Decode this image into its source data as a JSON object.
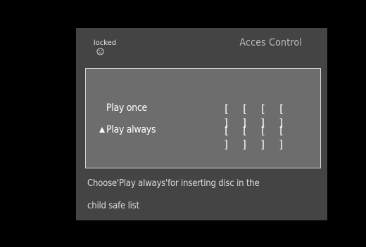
{
  "header": {
    "status_text": "locked",
    "status_icon": "sad-face-icon",
    "title": "Acces Control"
  },
  "options": [
    {
      "label": "Play once",
      "selected": false,
      "code": [
        "[ ]",
        "[ ]",
        "[ ]",
        "[ ]"
      ]
    },
    {
      "label": "Play always",
      "selected": true,
      "code": [
        "[ ]",
        "[ ]",
        "[ ]",
        "[ ]"
      ]
    }
  ],
  "hint": {
    "line1": "Choose'Play always'for inserting disc in the",
    "line2": "child safe list"
  },
  "colors": {
    "background": "#000000",
    "screen": "#444444",
    "panel": "#6d6d6d",
    "panel_border": "#d6d6d6",
    "text": "#ffffff"
  }
}
